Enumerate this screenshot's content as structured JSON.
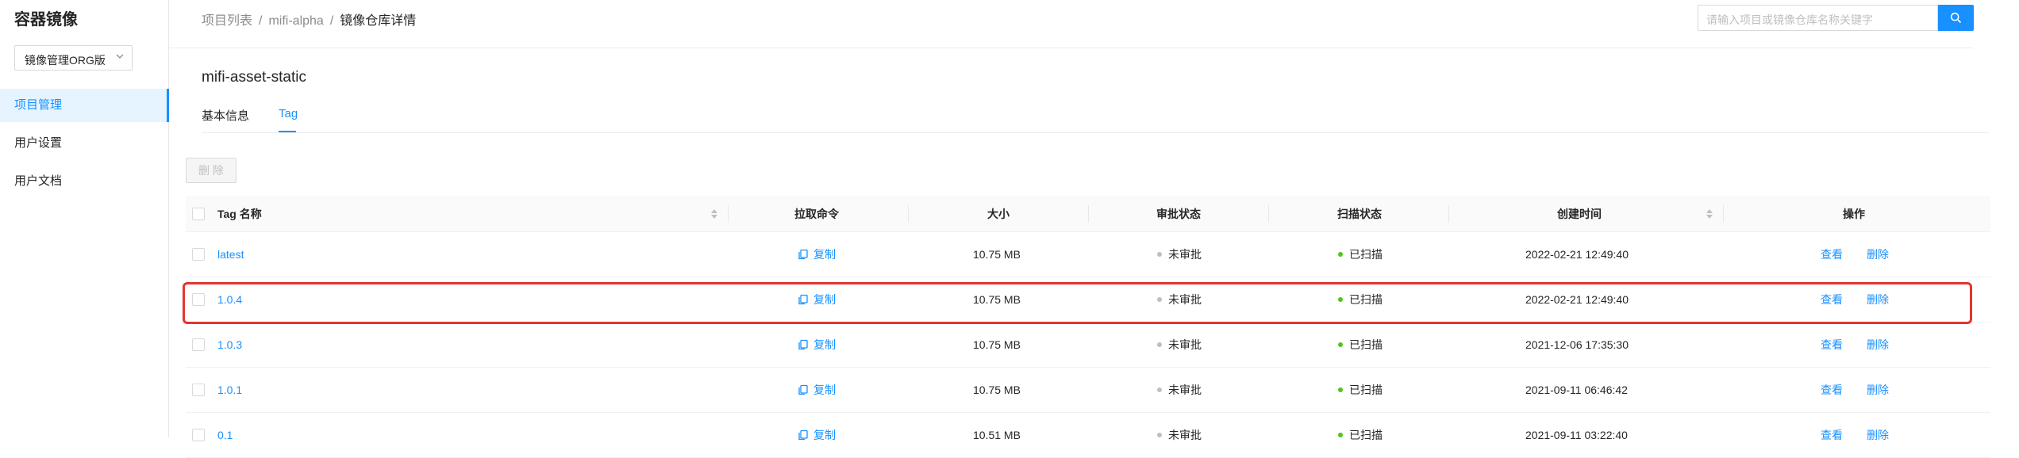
{
  "sidebar": {
    "title": "容器镜像",
    "org_select": "镜像管理ORG版",
    "items": [
      {
        "label": "项目管理"
      },
      {
        "label": "用户设置"
      },
      {
        "label": "用户文档"
      }
    ]
  },
  "breadcrumb": {
    "items": [
      "项目列表",
      "mifi-alpha",
      "镜像仓库详情"
    ],
    "separator": "/"
  },
  "search": {
    "placeholder": "请输入项目或镜像仓库名称关键字",
    "icon": "search-icon"
  },
  "repo": {
    "name": "mifi-asset-static"
  },
  "tabs": [
    {
      "label": "基本信息"
    },
    {
      "label": "Tag"
    }
  ],
  "toolbar": {
    "delete_label": "删 除"
  },
  "table": {
    "columns": [
      "Tag 名称",
      "拉取命令",
      "大小",
      "审批状态",
      "扫描状态",
      "创建时间",
      "操作"
    ],
    "rows": [
      {
        "tag": "latest",
        "pull": "复制",
        "size": "10.75 MB",
        "approval": "未审批",
        "scan": "已扫描",
        "created": "2022-02-21 12:49:40",
        "view": "查看",
        "delete": "删除"
      },
      {
        "tag": "1.0.4",
        "pull": "复制",
        "size": "10.75 MB",
        "approval": "未审批",
        "scan": "已扫描",
        "created": "2022-02-21 12:49:40",
        "view": "查看",
        "delete": "删除"
      },
      {
        "tag": "1.0.3",
        "pull": "复制",
        "size": "10.75 MB",
        "approval": "未审批",
        "scan": "已扫描",
        "created": "2021-12-06 17:35:30",
        "view": "查看",
        "delete": "删除"
      },
      {
        "tag": "1.0.1",
        "pull": "复制",
        "size": "10.75 MB",
        "approval": "未审批",
        "scan": "已扫描",
        "created": "2021-09-11 06:46:42",
        "view": "查看",
        "delete": "删除"
      },
      {
        "tag": "0.1",
        "pull": "复制",
        "size": "10.51 MB",
        "approval": "未审批",
        "scan": "已扫描",
        "created": "2021-09-11 03:22:40",
        "view": "查看",
        "delete": "删除"
      }
    ]
  },
  "colors": {
    "accent": "#1890ff",
    "scanned": "#52c41a",
    "unapproved": "#bfbfbf",
    "highlight": "#e5342f"
  }
}
